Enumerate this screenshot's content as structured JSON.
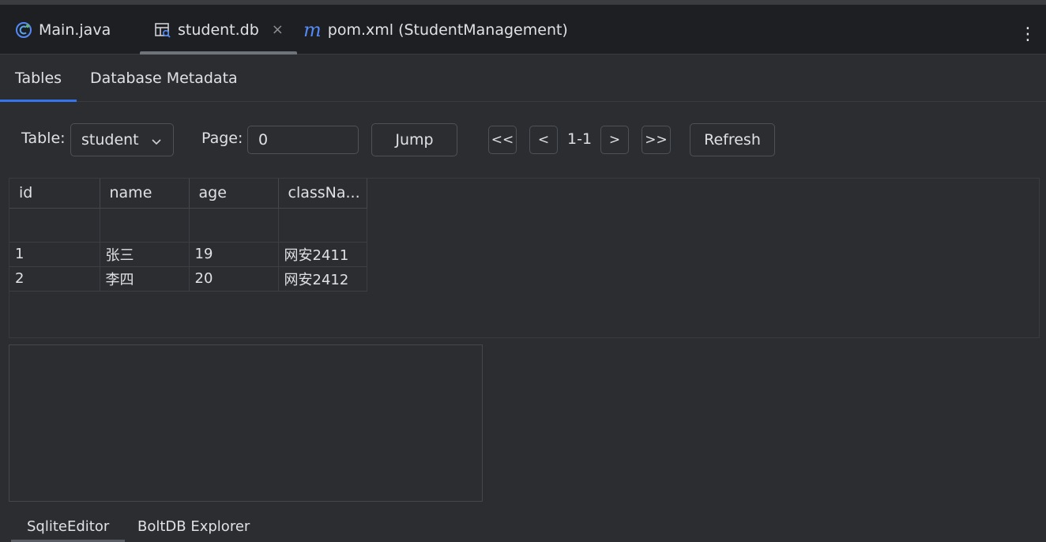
{
  "editor_tabs": [
    {
      "label": "Main.java",
      "icon": "java-class-icon"
    },
    {
      "label": "student.db",
      "icon": "database-table-icon",
      "active": true
    },
    {
      "label": "pom.xml (StudentManagement)",
      "icon": "maven-icon",
      "icon_glyph": "m"
    }
  ],
  "menu_glyph": "⋮",
  "close_glyph": "×",
  "sub_tabs": [
    {
      "label": "Tables",
      "active": true
    },
    {
      "label": "Database Metadata"
    }
  ],
  "toolbar": {
    "table_label": "Table:",
    "table_value": "student",
    "page_label": "Page:",
    "page_value": "0",
    "jump_label": "Jump",
    "first_label": "<<",
    "prev_label": "<",
    "page_info": "1-1",
    "next_label": ">",
    "last_label": ">>",
    "refresh_label": "Refresh"
  },
  "table": {
    "columns": [
      "id",
      "name",
      "age",
      "classNa..."
    ],
    "rows": [
      [
        "1",
        "张三",
        "19",
        "网安2411"
      ],
      [
        "2",
        "李四",
        "20",
        "网安2412"
      ]
    ]
  },
  "bottom_tabs": [
    {
      "label": "SqliteEditor",
      "active": true
    },
    {
      "label": "BoltDB Explorer"
    }
  ],
  "colors": {
    "background": "#2b2d30",
    "tabbar": "#1e1f22",
    "accent": "#3574f0",
    "maven": "#548af7"
  }
}
